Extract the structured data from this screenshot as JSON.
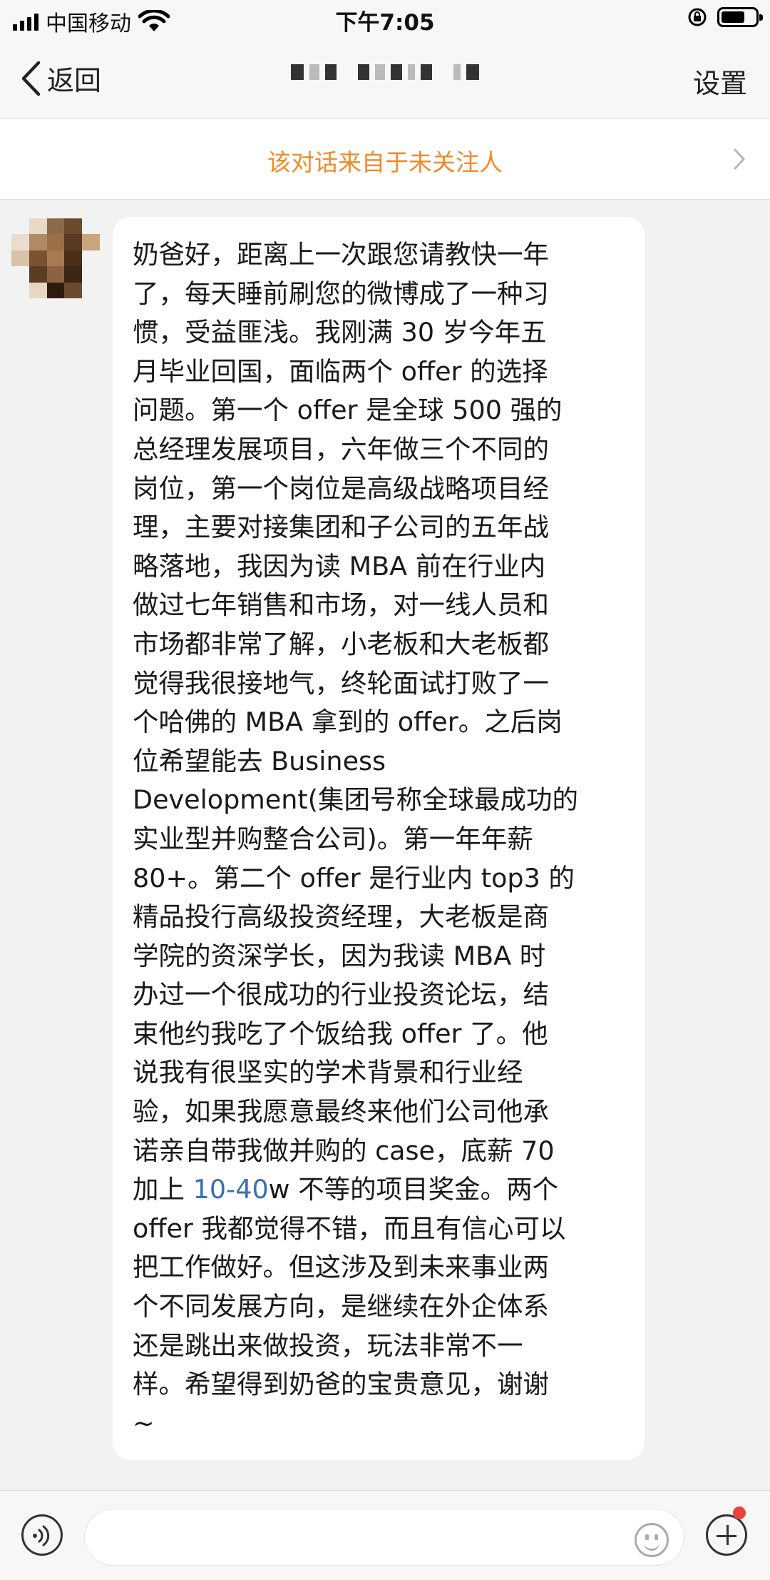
{
  "status_bar": {
    "carrier": "中国移动",
    "time": "下午7:05"
  },
  "nav": {
    "back_label": "返回",
    "settings_label": "设置"
  },
  "banner": {
    "text": "该对话来自于未关注人"
  },
  "message": {
    "lines": [
      "奶爸好，距离上一次跟您请教快一年",
      "了，每天睡前刷您的微博成了一种习",
      "惯，受益匪浅。我刚满 30 岁今年五",
      "月毕业回国，面临两个 offer 的选择",
      "问题。第一个 offer 是全球 500 强的",
      "总经理发展项目，六年做三个不同的",
      "岗位，第一个岗位是高级战略项目经",
      "理，主要对接集团和子公司的五年战",
      "略落地，我因为读 MBA 前在行业内",
      "做过七年销售和市场，对一线人员和",
      "市场都非常了解，小老板和大老板都",
      "觉得我很接地气，终轮面试打败了一",
      "个哈佛的 MBA 拿到的 offer。之后岗",
      "位希望能去 Business",
      "Development(集团号称全球最成功的",
      "实业型并购整合公司)。第一年年薪",
      "80+。第二个 offer 是行业内 top3 的",
      "精品投行高级投资经理，大老板是商",
      "学院的资深学长，因为我读 MBA 时",
      "办过一个很成功的行业投资论坛，结",
      "束他约我吃了个饭给我 offer 了。他",
      "说我有很坚实的学术背景和行业经",
      "验，如果我愿意最终来他们公司他承",
      "诺亲自带我做并购的 case，底薪 70"
    ],
    "line_link_prefix": "加上 ",
    "link_text": "10-40",
    "line_link_suffix": "w 不等的项目奖金。两个",
    "lines_after": [
      "offer 我都觉得不错，而且有信心可以",
      "把工作做好。但这涉及到未来事业两",
      "个不同发展方向，是继续在外企体系",
      "还是跳出来做投资，玩法非常不一",
      "样。希望得到奶爸的宝贵意见，谢谢",
      "~"
    ]
  },
  "colors": {
    "banner_text": "#f08a2a",
    "link": "#3b6fb6",
    "background": "#f2f2f2",
    "notification_dot": "#e8433a"
  },
  "icons": [
    "signal-icon",
    "wifi-icon",
    "rotation-lock-icon",
    "battery-icon",
    "chevron-left-icon",
    "chevron-right-icon",
    "voice-icon",
    "emoji-icon",
    "plus-icon"
  ]
}
